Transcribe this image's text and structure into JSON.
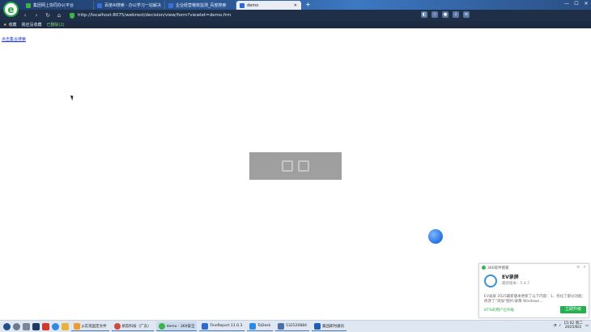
{
  "browser": {
    "tabs": [
      {
        "title": "集团网上协同办公平台",
        "active": false
      },
      {
        "title": "百度AI搜索 - 办公学习一站解决",
        "active": false
      },
      {
        "title": "企业经营稽核监测_百度搜索",
        "active": false
      },
      {
        "title": "demo",
        "active": true
      }
    ],
    "new_tab": "+",
    "address": "http://localhost:8075/webroot/decision/view/form?viewlet=demo.frm",
    "bookmarks": [
      "收藏",
      "我还没收藏",
      "已删除(2)"
    ]
  },
  "page": {
    "link_text": "点击集合搜索"
  },
  "popup": {
    "header": "360软件管家",
    "app_name": "EV录屏",
    "version": "最新版本：5.4.7",
    "description": "EV录屏 2025最新版本更新了以下内容：1、优化了部分功能；修改了“添加”图片/录像 Windows...",
    "percent": "87%的用户已升级",
    "button": "立即升级"
  },
  "taskbar": {
    "apps": [
      {
        "label": "js实现固定文件",
        "color": "#f29a2e"
      },
      {
        "label": "帆软科技（广东）",
        "color": "#d34b3a"
      },
      {
        "label": "demo - 360安全",
        "color": "#3bb34a"
      },
      {
        "label": "FineReport 11.0.3",
        "color": "#2c6bd1"
      },
      {
        "label": "ToDesk",
        "color": "#2a8ae8"
      },
      {
        "label": "532520884",
        "color": "#4b6fa8"
      },
      {
        "label": "集团即时通讯",
        "color": "#1d5fb8"
      }
    ],
    "time": "15:02 周二",
    "date": "2025/8/2"
  },
  "colors": {
    "brand_green": "#2aa745",
    "link_blue": "#1a33cc"
  }
}
